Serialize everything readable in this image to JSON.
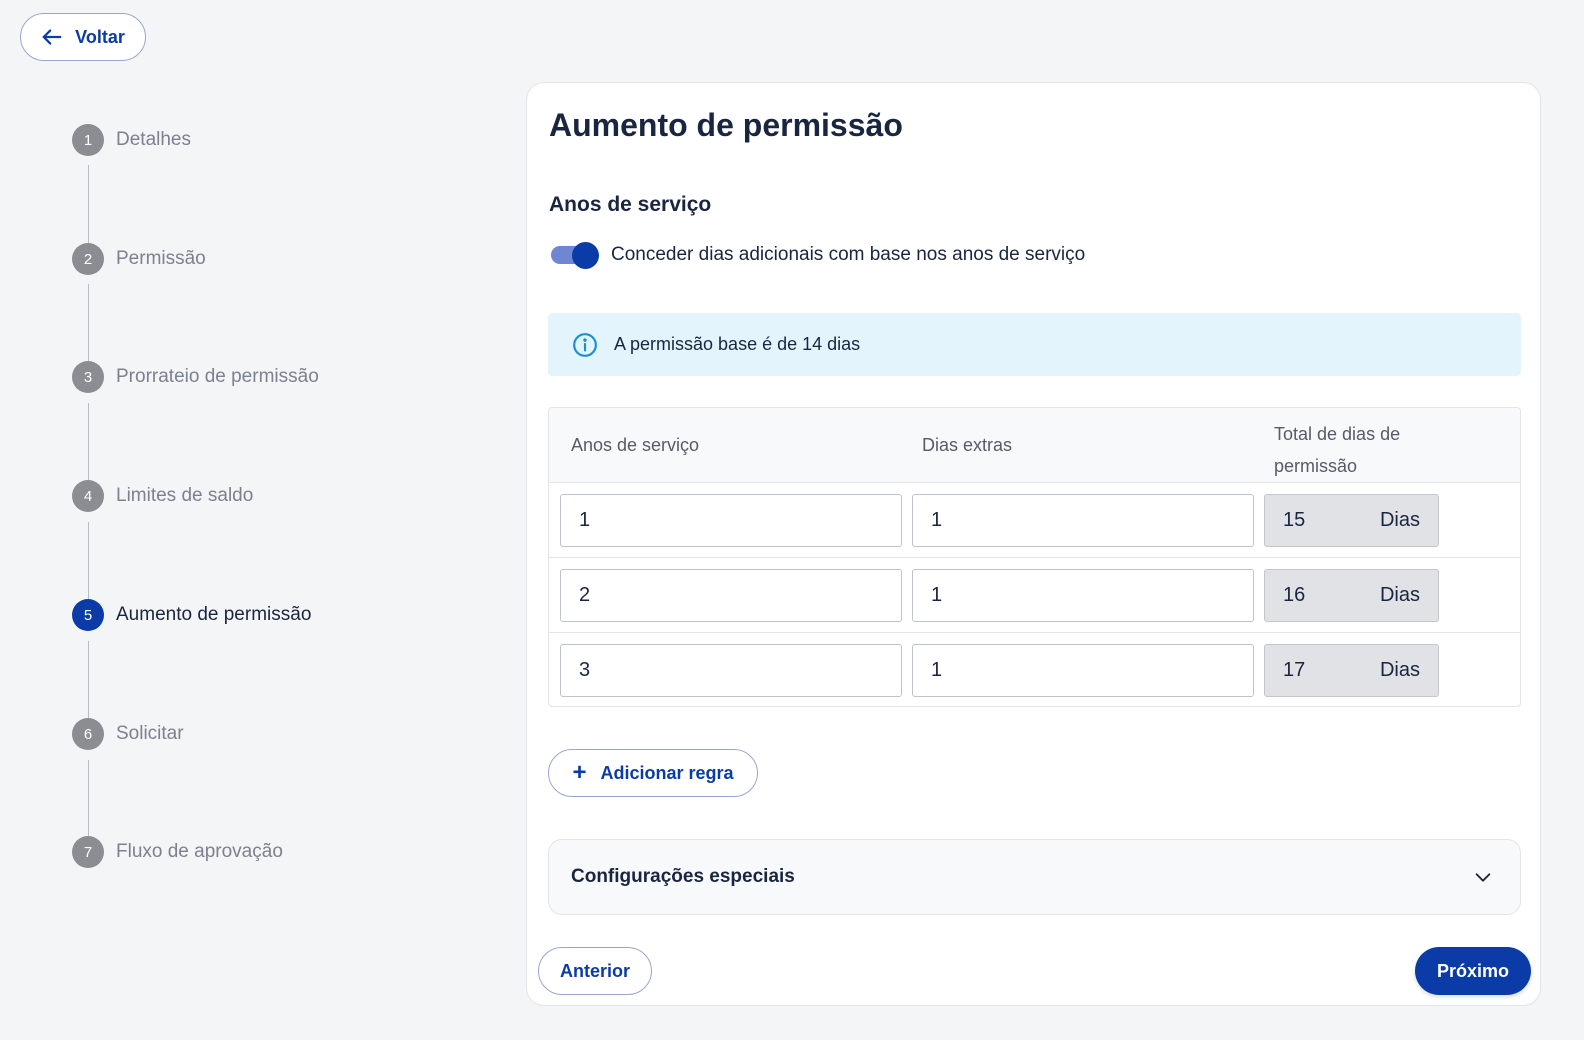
{
  "back_button": {
    "label": "Voltar",
    "icon": "arrow-left-icon"
  },
  "steps": [
    {
      "number": "1",
      "label": "Detalhes",
      "active": false
    },
    {
      "number": "2",
      "label": "Permissão",
      "active": false
    },
    {
      "number": "3",
      "label": "Prorrateio de permissão",
      "active": false
    },
    {
      "number": "4",
      "label": "Limites de saldo",
      "active": false
    },
    {
      "number": "5",
      "label": "Aumento de permissão",
      "active": true
    },
    {
      "number": "6",
      "label": "Solicitar",
      "active": false
    },
    {
      "number": "7",
      "label": "Fluxo de aprovação",
      "active": false
    }
  ],
  "main": {
    "title": "Aumento de permissão",
    "section_title": "Anos de serviço",
    "toggle": {
      "label": "Conceder dias adicionais com base nos anos de serviço",
      "on": true
    },
    "info": {
      "icon": "info-icon",
      "text": "A permissão base é de 14 dias"
    },
    "table": {
      "headers": [
        "Anos de serviço",
        "Dias extras",
        "Total de dias de permissão"
      ],
      "rows": [
        {
          "years": "1",
          "extra": "1",
          "total": "15",
          "unit": "Dias"
        },
        {
          "years": "2",
          "extra": "1",
          "total": "16",
          "unit": "Dias"
        },
        {
          "years": "3",
          "extra": "1",
          "total": "17",
          "unit": "Dias"
        }
      ]
    },
    "add_rule_label": "Adicionar regra",
    "special_settings_label": "Configurações especiais",
    "prev_label": "Anterior",
    "next_label": "Próximo"
  },
  "colors": {
    "accent": "#0b3ba6",
    "info_bg": "#e3f4fc",
    "info_icon": "#1a8fd1",
    "step_inactive": "#8a8d92"
  }
}
